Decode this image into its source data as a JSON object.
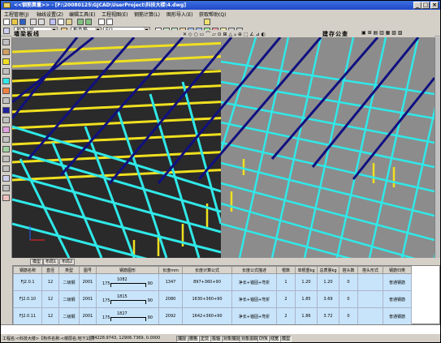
{
  "titlebar": {
    "title": "<<钢筋算量>> - [F:\\20080125\\GJCAD\\UserProject\\科技大楼\\4.dwg]",
    "buttons": [
      "_",
      "□",
      "×"
    ]
  },
  "menubar": {
    "items": [
      "工程管理(J)",
      "轴线设置(Z)",
      "编辑工具(E)",
      "工程视图(E)",
      "钢筋计算(L)",
      "图形导入(E)",
      "获取帮助(Q)"
    ]
  },
  "toolbar2": {
    "floor_select": "地下1层",
    "component_select": "板负筋",
    "name_select": "FJ2"
  },
  "toolbar3": {
    "panel_title": "墙梁板线",
    "right_title": "建存公查"
  },
  "view_tabs": [
    "模型",
    "布局1",
    "布局2"
  ],
  "table": {
    "headers": [
      "钢筋名称",
      "直径",
      "类型",
      "图号",
      "钢筋图形",
      "长度mm",
      "长度计算公式",
      "长度公式描述",
      "根数",
      "单根重kg",
      "总质量kg",
      "搭头数",
      "搭头形式",
      "钢筋归类"
    ],
    "rows": [
      {
        "name": "FJ2.0.1",
        "dia": "12",
        "type": "二级钢",
        "fig": "2001",
        "shape_left": "175",
        "shape_mid": "1082",
        "shape_right": "90",
        "length": "1347",
        "formula": "897+360+90",
        "desc": "净长+锚固+弯折",
        "count": "1",
        "unit_w": "1.20",
        "total_w": "1.20",
        "splices": "0",
        "splice_type": "",
        "category": "普通钢筋"
      },
      {
        "name": "FJ2.0.10",
        "dia": "12",
        "type": "二级钢",
        "fig": "2001",
        "shape_left": "175",
        "shape_mid": "1815",
        "shape_right": "90",
        "length": "2080",
        "formula": "1630+360+90",
        "desc": "净长+锚固+弯折",
        "count": "2",
        "unit_w": "1.85",
        "total_w": "3.69",
        "splices": "0",
        "splice_type": "",
        "category": "普通钢筋"
      },
      {
        "name": "FJ2.0.11",
        "dia": "12",
        "type": "二级钢",
        "fig": "2001",
        "shape_left": "175",
        "shape_mid": "1827",
        "shape_right": "90",
        "length": "2092",
        "formula": "1642+360+90",
        "desc": "净长+锚固+弯折",
        "count": "2",
        "unit_w": "1.86",
        "total_w": "3.72",
        "splices": "0",
        "splice_type": "",
        "category": "普通钢筋"
      }
    ]
  },
  "statusbar": {
    "project_label": "工程名:<科技大楼>【构件名称:<楼层名:地下1层】",
    "coords": "84228.9743, 12906.7369, 0.0000",
    "modes": [
      "捕捉",
      "栅格",
      "正交",
      "极轴",
      "对象捕捉",
      "对象追踪",
      "DYN",
      "线宽",
      "模型"
    ]
  },
  "colors": {
    "rebar_yellow": "#f0e020",
    "rebar_cyan": "#30e8e8",
    "rebar_navy": "#101080",
    "slab_dark": "#2a2a2a",
    "slab_gray": "#8c8c8c",
    "titlebar": "#1f48c8",
    "table_row": "#c8e4fa"
  }
}
